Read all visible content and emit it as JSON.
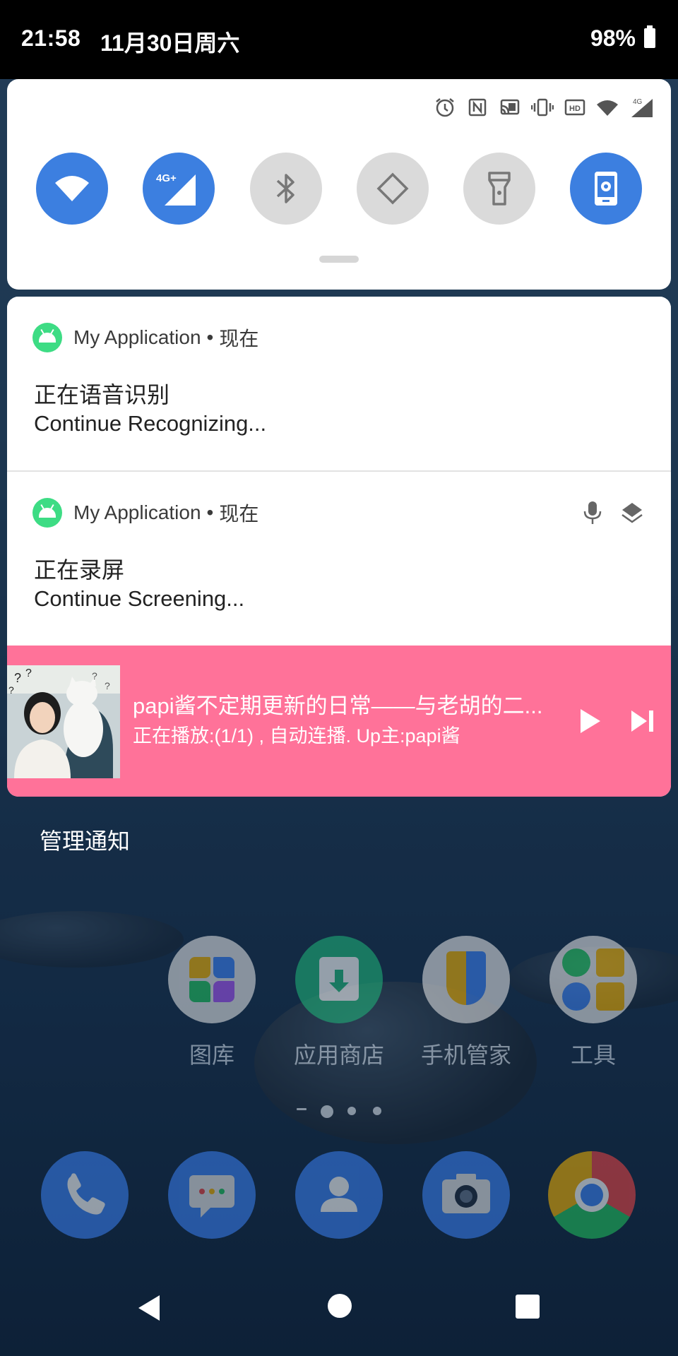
{
  "status_bar": {
    "time": "21:58",
    "date": "11月30日周六",
    "battery": "98%",
    "network_type": "4G"
  },
  "quick_settings": {
    "tiles": [
      {
        "name": "wifi",
        "state": "on"
      },
      {
        "name": "mobile-data",
        "label": "4G+",
        "state": "on"
      },
      {
        "name": "bluetooth",
        "state": "off"
      },
      {
        "name": "auto-rotate",
        "state": "off"
      },
      {
        "name": "flashlight",
        "state": "off"
      },
      {
        "name": "screen-record",
        "state": "on"
      }
    ],
    "status_icons": [
      "alarm-icon",
      "nfc-icon",
      "cast-icon",
      "vibrate-icon",
      "hd-icon",
      "wifi-icon",
      "signal-icon"
    ]
  },
  "notifications": [
    {
      "app": "My Application",
      "separator": "•",
      "time": "现在",
      "title": "正在语音识别",
      "text": "Continue Recognizing..."
    },
    {
      "app": "My Application",
      "separator": "•",
      "time": "现在",
      "title": "正在录屏",
      "text": "Continue Screening...",
      "actions": [
        "mic-icon",
        "layers-icon"
      ]
    }
  ],
  "media": {
    "title": "papi酱不定期更新的日常——与老胡的二...",
    "subtitle": "正在播放:(1/1) , 自动连播. Up主:papi酱",
    "background": "#ff7299"
  },
  "manage_label": "管理通知",
  "home": {
    "apps": [
      {
        "label": "图库"
      },
      {
        "label": "应用商店"
      },
      {
        "label": "手机管家"
      },
      {
        "label": "工具"
      }
    ],
    "dock": [
      "phone-icon",
      "messages-icon",
      "contacts-icon",
      "camera-icon",
      "chrome-icon"
    ]
  },
  "colors": {
    "accent": "#3c7fe0",
    "tile_off": "#dadada",
    "android_green": "#3ddc84"
  }
}
